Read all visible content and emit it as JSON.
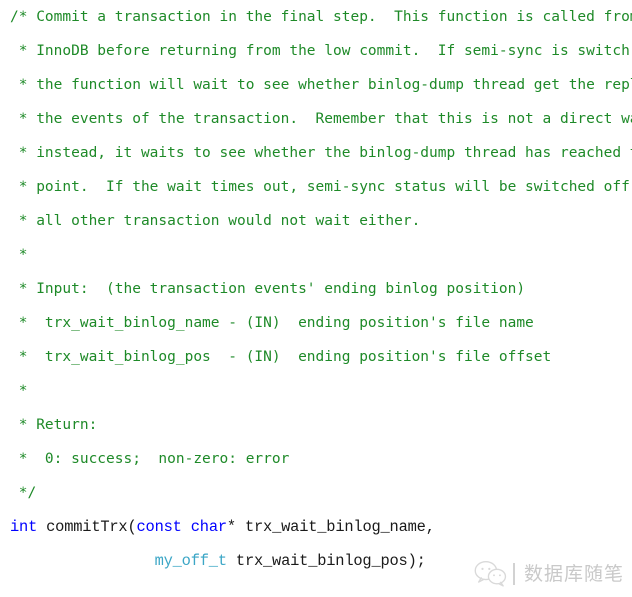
{
  "document": {
    "kind": "source-code-snippet",
    "language": "C++",
    "background_color": "#ffffff",
    "comment_color": "#1e8a28",
    "keyword_color": "#0000ff",
    "type_color": "#3ba6c6",
    "plain_code_color": "#1a1a1a"
  },
  "lines": [
    {
      "type": "comment",
      "text": "/* Commit a transaction in the final step.  This function is called from"
    },
    {
      "type": "comment",
      "text": " * InnoDB before returning from the low commit.  If semi-sync is switch on,"
    },
    {
      "type": "comment",
      "text": " * the function will wait to see whether binlog-dump thread get the reply for"
    },
    {
      "type": "comment",
      "text": " * the events of the transaction.  Remember that this is not a direct wait,"
    },
    {
      "type": "comment",
      "text": " * instead, it waits to see whether the binlog-dump thread has reached the"
    },
    {
      "type": "comment",
      "text": " * point.  If the wait times out, semi-sync status will be switched off and"
    },
    {
      "type": "comment",
      "text": " * all other transaction would not wait either."
    },
    {
      "type": "comment",
      "text": " *"
    },
    {
      "type": "comment",
      "text": " * Input:  (the transaction events' ending binlog position)"
    },
    {
      "type": "comment",
      "text": " *  trx_wait_binlog_name - (IN)  ending position's file name"
    },
    {
      "type": "comment",
      "text": " *  trx_wait_binlog_pos  - (IN)  ending position's file offset"
    },
    {
      "type": "comment",
      "text": " *"
    },
    {
      "type": "comment",
      "text": " * Return:"
    },
    {
      "type": "comment",
      "text": " *  0: success;  non-zero: error"
    },
    {
      "type": "comment",
      "text": " */"
    }
  ],
  "code_lines": [
    {
      "id": "signature-line-1",
      "tokens": [
        {
          "cls": "tok-keyword",
          "text": "int"
        },
        {
          "cls": "tok-plain",
          "text": " commitTrx("
        },
        {
          "cls": "tok-keyword",
          "text": "const"
        },
        {
          "cls": "tok-plain",
          "text": " "
        },
        {
          "cls": "tok-keyword",
          "text": "char"
        },
        {
          "cls": "tok-plain",
          "text": "* trx_wait_binlog_name,"
        }
      ]
    },
    {
      "id": "signature-line-2",
      "tokens": [
        {
          "cls": "tok-plain",
          "text": "                "
        },
        {
          "cls": "tok-type",
          "text": "my_off_t"
        },
        {
          "cls": "tok-plain",
          "text": " trx_wait_binlog_pos);"
        }
      ]
    }
  ],
  "watermark": {
    "icon": "wechat-icon",
    "text": "数据库随笔",
    "color": "#c9c9c9",
    "separator_color": "#d2d2d2"
  }
}
